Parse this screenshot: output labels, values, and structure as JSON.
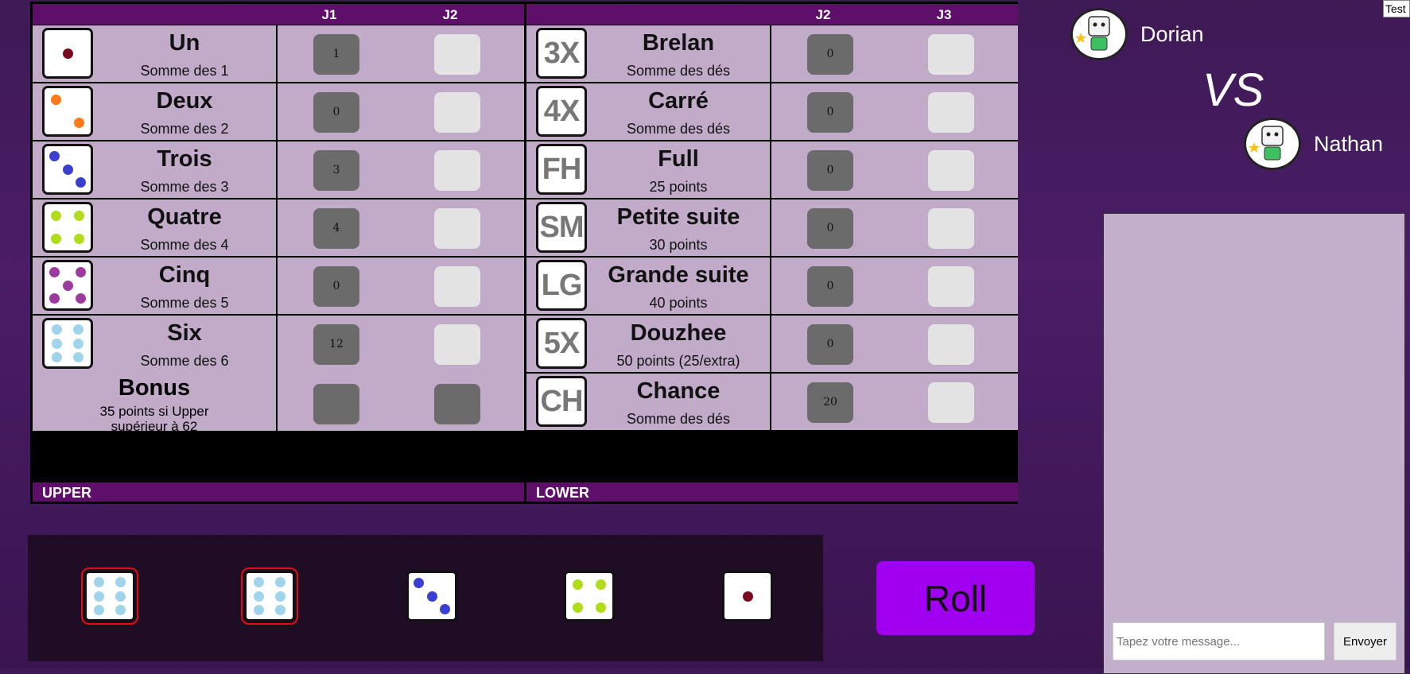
{
  "board": {
    "upper": {
      "col1": "J1",
      "col2": "J2",
      "footer": "UPPER",
      "rows": [
        {
          "title": "Un",
          "desc": "Somme des 1",
          "j1": "1",
          "j2": ""
        },
        {
          "title": "Deux",
          "desc": "Somme des 2",
          "j1": "0",
          "j2": ""
        },
        {
          "title": "Trois",
          "desc": "Somme des 3",
          "j1": "3",
          "j2": ""
        },
        {
          "title": "Quatre",
          "desc": "Somme des 4",
          "j1": "4",
          "j2": ""
        },
        {
          "title": "Cinq",
          "desc": "Somme des 5",
          "j1": "0",
          "j2": ""
        },
        {
          "title": "Six",
          "desc": "Somme des 6",
          "j1": "12",
          "j2": ""
        }
      ],
      "bonus": {
        "title": "Bonus",
        "desc_line1": "35 points si Upper",
        "desc_line2": "supérieur à 62"
      }
    },
    "lower": {
      "col1": "J2",
      "col2": "J3",
      "footer": "LOWER",
      "rows": [
        {
          "code": "3X",
          "title": "Brelan",
          "desc": "Somme des dés",
          "j1": "0",
          "j2": ""
        },
        {
          "code": "4X",
          "title": "Carré",
          "desc": "Somme des dés",
          "j1": "0",
          "j2": ""
        },
        {
          "code": "FH",
          "title": "Full",
          "desc": "25 points",
          "j1": "0",
          "j2": ""
        },
        {
          "code": "SM",
          "title": "Petite suite",
          "desc": "30 points",
          "j1": "0",
          "j2": ""
        },
        {
          "code": "LG",
          "title": "Grande suite",
          "desc": "40 points",
          "j1": "0",
          "j2": ""
        },
        {
          "code": "5X",
          "title": "Douzhee",
          "desc": "50 points (25/extra)",
          "j1": "0",
          "j2": ""
        },
        {
          "code": "CH",
          "title": "Chance",
          "desc": "Somme des dés",
          "j1": "20",
          "j2": ""
        }
      ]
    }
  },
  "dice_colors": {
    "1": "#7a0a1e",
    "2": "#ff7a1a",
    "3": "#3a3fd0",
    "4": "#b0dc1a",
    "5": "#9c3aa0",
    "6": "#9fd4ea"
  },
  "tray_dice": [
    {
      "value": 6,
      "held": true
    },
    {
      "value": 6,
      "held": true
    },
    {
      "value": 3,
      "held": false
    },
    {
      "value": 4,
      "held": false
    },
    {
      "value": 1,
      "held": false
    }
  ],
  "roll_label": "Roll",
  "players": {
    "p1": "Dorian",
    "p2": "Nathan",
    "vs": "VS"
  },
  "chat": {
    "placeholder": "Tapez votre message...",
    "send_label": "Envoyer"
  },
  "test_label": "Test"
}
